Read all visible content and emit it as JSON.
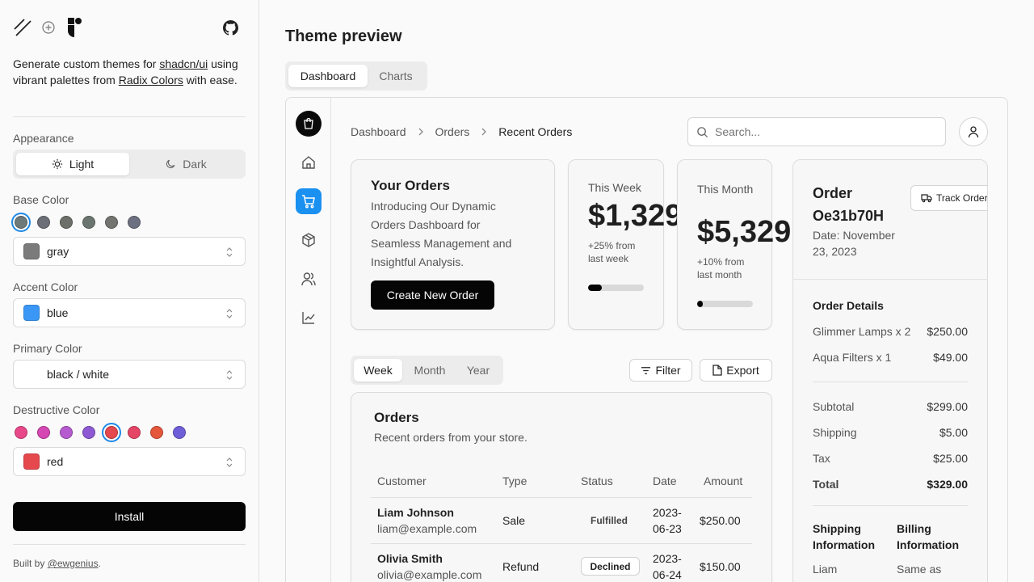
{
  "sidebar": {
    "intro_pre": "Generate custom themes for ",
    "intro_link1": "shadcn/ui",
    "intro_mid": " using vibrant palettes from ",
    "intro_link2": "Radix Colors",
    "intro_post": " with ease.",
    "appearance_label": "Appearance",
    "appearance_light": "Light",
    "appearance_dark": "Dark",
    "base_label": "Base Color",
    "base_dots": [
      "#6e7a7a",
      "#6d6f78",
      "#6c7068",
      "#6b7570",
      "#737370",
      "#6d7080"
    ],
    "base_value": "gray",
    "base_swatch": "#7b7b7b",
    "accent_label": "Accent Color",
    "accent_value": "blue",
    "accent_swatch": "#3b97f5",
    "primary_label": "Primary Color",
    "primary_value": "black / white",
    "destructive_label": "Destructive Color",
    "destructive_dots": [
      "#e8488a",
      "#d547b2",
      "#b65ad0",
      "#8e59d4",
      "#e5484d",
      "#e54666",
      "#e5573a",
      "#6e5fd8"
    ],
    "destructive_value": "red",
    "destructive_swatch": "#e5484d",
    "install_label": "Install",
    "footer_pre": "Built by ",
    "footer_link": "@ewgenius",
    "footer_post": "."
  },
  "main": {
    "title": "Theme preview",
    "tabs": [
      "Dashboard",
      "Charts"
    ],
    "breadcrumb": [
      "Dashboard",
      "Orders",
      "Recent Orders"
    ],
    "search_placeholder": "Search...",
    "your_orders": {
      "title": "Your Orders",
      "desc": "Introducing Our Dynamic Orders Dashboard for Seamless Management and Insightful Analysis.",
      "button": "Create New Order"
    },
    "week": {
      "label": "This Week",
      "value": "$1,329",
      "delta": "+25% from last week",
      "progress": 0.25
    },
    "month": {
      "label": "This Month",
      "value": "$5,329",
      "delta": "+10% from last month",
      "progress": 0.1
    },
    "range_tabs": [
      "Week",
      "Month",
      "Year"
    ],
    "filter_label": "Filter",
    "export_label": "Export",
    "orders_table": {
      "title": "Orders",
      "subtitle": "Recent orders from your store.",
      "headers": [
        "Customer",
        "Type",
        "Status",
        "Date",
        "Amount"
      ],
      "rows": [
        {
          "name": "Liam Johnson",
          "email": "liam@example.com",
          "type": "Sale",
          "status": "Fulfilled",
          "date1": "2023-",
          "date2": "06-23",
          "amount": "$250.00"
        },
        {
          "name": "Olivia Smith",
          "email": "olivia@example.com",
          "type": "Refund",
          "status": "Declined",
          "date1": "2023-",
          "date2": "06-24",
          "amount": "$150.00"
        }
      ]
    },
    "order": {
      "title1": "Order",
      "title2": "Oe31b70H",
      "date1": "Date: November",
      "date2": "23, 2023",
      "track_label": "Track Order",
      "details_title": "Order Details",
      "items": [
        {
          "label": "Glimmer Lamps x 2",
          "value": "$250.00"
        },
        {
          "label": "Aqua Filters x 1",
          "value": "$49.00"
        }
      ],
      "summary": [
        {
          "label": "Subtotal",
          "value": "$299.00"
        },
        {
          "label": "Shipping",
          "value": "$5.00"
        },
        {
          "label": "Tax",
          "value": "$25.00"
        }
      ],
      "total_label": "Total",
      "total_value": "$329.00",
      "shipping_title1": "Shipping",
      "shipping_title2": "Information",
      "billing_title1": "Billing",
      "billing_title2": "Information",
      "shipping_first": "Liam",
      "billing_first": "Same as"
    }
  }
}
